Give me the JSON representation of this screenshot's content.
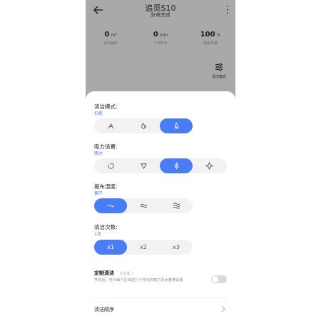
{
  "header": {
    "title": "追觅S10",
    "subtitle": "充电完成"
  },
  "stats": [
    {
      "value": "0",
      "unit": "m²",
      "label": "清扫面积"
    },
    {
      "value": "0",
      "unit": "min",
      "label": "工作时长"
    },
    {
      "value": "100",
      "unit": "%",
      "label": "剩余电量"
    }
  ],
  "side_button": {
    "label": "清洁模式"
  },
  "sections": {
    "clean_mode": {
      "title": "清洁模式:",
      "current": "扫拖",
      "options": [
        "sweep-icon",
        "mop-icon",
        "sweep-mop-icon"
      ],
      "active_index": 2
    },
    "suction": {
      "title": "吸力设置:",
      "current": "强力",
      "options": [
        "quiet-icon",
        "standard-icon",
        "strong-icon",
        "max-icon"
      ],
      "active_index": 2
    },
    "humidity": {
      "title": "拖布湿度:",
      "current": "偏干",
      "options": [
        "dry-icon",
        "moist-icon",
        "wet-icon"
      ],
      "active_index": 0
    },
    "passes": {
      "title": "清洁次数:",
      "current": "1次",
      "options": [
        "x1",
        "x2",
        "x3"
      ],
      "active_index": 0
    }
  },
  "custom": {
    "title": "定制清洁",
    "hint": "去设置 >",
    "desc": "开启后，可对每个区域进行个性化的吸力及水量等设置",
    "enabled": false
  },
  "order": {
    "label": "清洁顺序"
  },
  "colors": {
    "accent": "#4a7cf3",
    "overlay": "#a9a9a9"
  }
}
